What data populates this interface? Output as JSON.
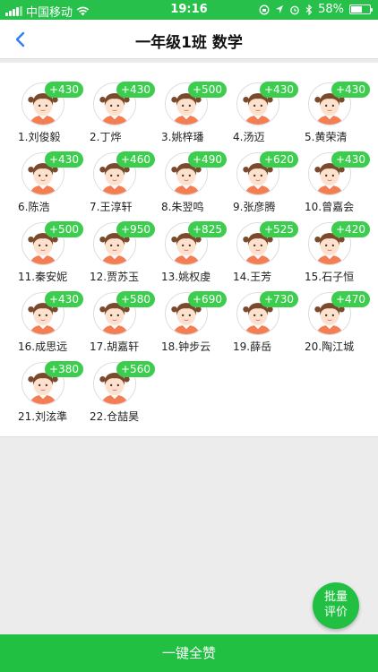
{
  "status_bar": {
    "carrier": "中国移动",
    "time": "19:16",
    "battery": "58%",
    "battery_level": 0.58
  },
  "nav": {
    "title": "一年级1班 数学"
  },
  "students": [
    {
      "name": "1.刘俊毅",
      "score": "+430"
    },
    {
      "name": "2.丁烨",
      "score": "+430"
    },
    {
      "name": "3.姚梓璠",
      "score": "+500"
    },
    {
      "name": "4.汤迈",
      "score": "+430"
    },
    {
      "name": "5.黄荣清",
      "score": "+430"
    },
    {
      "name": "6.陈浩",
      "score": "+430"
    },
    {
      "name": "7.王淳轩",
      "score": "+460"
    },
    {
      "name": "8.朱翌鸣",
      "score": "+490"
    },
    {
      "name": "9.张彦腾",
      "score": "+620"
    },
    {
      "name": "10.曾嘉会",
      "score": "+430"
    },
    {
      "name": "11.秦安妮",
      "score": "+500"
    },
    {
      "name": "12.贾苏玉",
      "score": "+950"
    },
    {
      "name": "13.姚权虔",
      "score": "+825"
    },
    {
      "name": "14.王芳",
      "score": "+525"
    },
    {
      "name": "15.石子恒",
      "score": "+420"
    },
    {
      "name": "16.成思远",
      "score": "+430"
    },
    {
      "name": "17.胡嘉轩",
      "score": "+580"
    },
    {
      "name": "18.钟步云",
      "score": "+690"
    },
    {
      "name": "19.薛岳",
      "score": "+730"
    },
    {
      "name": "20.陶江城",
      "score": "+470"
    },
    {
      "name": "21.刘泫準",
      "score": "+380"
    },
    {
      "name": "22.仓喆昊",
      "score": "+560"
    }
  ],
  "fab": {
    "line1": "批量",
    "line2": "评价"
  },
  "bottom_button": {
    "label": "一键全赞"
  },
  "colors": {
    "status_bar_bg": "#27c04a",
    "accent_green": "#21c043",
    "badge_green": "#3ccd4f",
    "back_arrow": "#2f7ef5"
  }
}
